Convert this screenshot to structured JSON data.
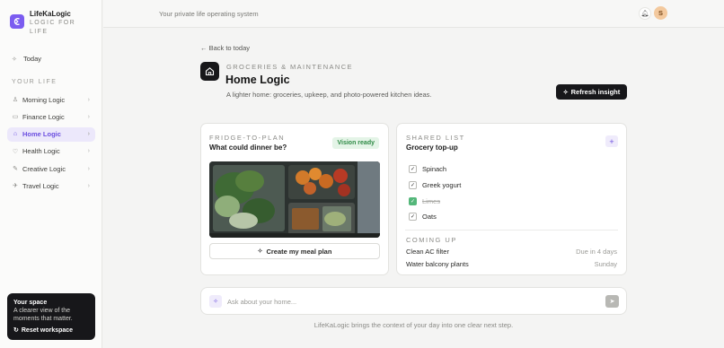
{
  "brand": {
    "name": "LifeKaLogic",
    "tagline": "LOGIC FOR LIFE"
  },
  "sidebar": {
    "today_label": "Today",
    "section_label": "YOUR LIFE",
    "items": [
      {
        "label": "Morning Logic",
        "icon": "person-icon"
      },
      {
        "label": "Finance Logic",
        "icon": "wallet-icon"
      },
      {
        "label": "Home Logic",
        "icon": "home-icon",
        "active": true
      },
      {
        "label": "Health Logic",
        "icon": "heart-icon"
      },
      {
        "label": "Creative Logic",
        "icon": "pen-icon"
      },
      {
        "label": "Travel Logic",
        "icon": "plane-icon"
      }
    ],
    "space_card": {
      "title": "Your space",
      "description": "A clearer view of the moments that matter.",
      "reset_label": "Reset workspace"
    }
  },
  "topbar": {
    "tagline": "Your private life operating system",
    "avatar_initial": "S"
  },
  "header": {
    "back_label": "← Back to today",
    "eyebrow": "GROCERIES & MAINTENANCE",
    "title": "Home Logic",
    "subtitle": "A lighter home: groceries, upkeep, and photo-powered kitchen ideas.",
    "refresh_label": "Refresh insight"
  },
  "fridge_card": {
    "eyebrow": "FRIDGE-TO-PLAN",
    "title": "What could dinner be?",
    "badge": "Vision ready",
    "button_label": "Create my meal plan"
  },
  "list_card": {
    "eyebrow": "SHARED LIST",
    "title": "Grocery top-up",
    "items": [
      {
        "label": "Spinach",
        "checked": false
      },
      {
        "label": "Greek yogurt",
        "checked": false
      },
      {
        "label": "Limes",
        "checked": true
      },
      {
        "label": "Oats",
        "checked": false
      }
    ],
    "coming_up_label": "COMING UP",
    "coming_up": [
      {
        "task": "Clean AC filter",
        "when": "Due in 4 days"
      },
      {
        "task": "Water balcony plants",
        "when": "Sunday"
      }
    ]
  },
  "ask": {
    "placeholder": "Ask about your home..."
  },
  "footer": "LifeKaLogic brings the context of your day into one clear next step.",
  "colors": {
    "accent": "#7b5cf0",
    "dark": "#17171a",
    "success": "#54b77a"
  }
}
